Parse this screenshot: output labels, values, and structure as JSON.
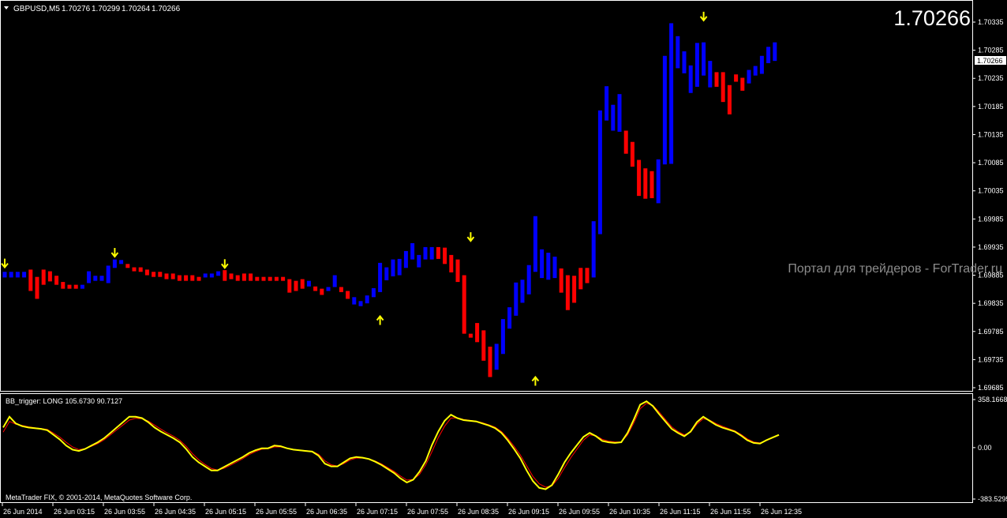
{
  "main_panel": {
    "symbol_header": "GBPUSD,M5",
    "ohlc_values": [
      "1.70276",
      "1.70299",
      "1.70264",
      "1.70266"
    ],
    "last_price_big": "1.70266",
    "current_price_tag": "1.70266",
    "watermark": "Портал для трейдеров - ForTrader.ru",
    "price_scale": [
      "1.70335",
      "1.70285",
      "1.70235",
      "1.70185",
      "1.70135",
      "1.70085",
      "1.70035",
      "1.69985",
      "1.69935",
      "1.69885",
      "1.69835",
      "1.69785",
      "1.69735",
      "1.69685"
    ]
  },
  "indicator_panel": {
    "label": "BB_trigger: LONG 105.6730 90.7127",
    "scale": [
      "358.1668",
      "0.00",
      "-383.5295"
    ],
    "copyright": "MetaTrader FIX, © 2001-2014, MetaQuotes Software Corp."
  },
  "time_axis": [
    "26 Jun 2014",
    "26 Jun 03:15",
    "26 Jun 03:55",
    "26 Jun 04:35",
    "26 Jun 05:15",
    "26 Jun 05:55",
    "26 Jun 06:35",
    "26 Jun 07:15",
    "26 Jun 07:55",
    "26 Jun 08:35",
    "26 Jun 09:15",
    "26 Jun 09:55",
    "26 Jun 10:35",
    "26 Jun 11:15",
    "26 Jun 11:55",
    "26 Jun 12:35"
  ],
  "colors": {
    "up": "#0000ff",
    "down": "#ff0000",
    "arrow": "#ffff00",
    "osc_main": "#ffff00",
    "osc_signal": "#ff0000",
    "axis": "#ffffff"
  },
  "chart_data": {
    "type": "bar",
    "bars": [
      {
        "open": 1.69891,
        "close": 1.69881,
        "dir": "up"
      },
      {
        "open": 1.69891,
        "close": 1.69881,
        "dir": "up"
      },
      {
        "open": 1.69891,
        "close": 1.69881,
        "dir": "up"
      },
      {
        "open": 1.69891,
        "close": 1.69881,
        "dir": "up"
      },
      {
        "open": 1.69895,
        "close": 1.69857,
        "dir": "down"
      },
      {
        "open": 1.69882,
        "close": 1.69843,
        "dir": "down"
      },
      {
        "open": 1.69895,
        "close": 1.69868,
        "dir": "down"
      },
      {
        "open": 1.69892,
        "close": 1.69874,
        "dir": "down"
      },
      {
        "open": 1.69884,
        "close": 1.69868,
        "dir": "down"
      },
      {
        "open": 1.69873,
        "close": 1.69861,
        "dir": "down"
      },
      {
        "open": 1.69868,
        "close": 1.69861,
        "dir": "down"
      },
      {
        "open": 1.69868,
        "close": 1.69861,
        "dir": "down"
      },
      {
        "open": 1.69861,
        "close": 1.69868,
        "dir": "up"
      },
      {
        "open": 1.69871,
        "close": 1.69892,
        "dir": "up"
      },
      {
        "open": 1.69875,
        "close": 1.69884,
        "dir": "up"
      },
      {
        "open": 1.69875,
        "close": 1.69884,
        "dir": "up"
      },
      {
        "open": 1.69871,
        "close": 1.69902,
        "dir": "up"
      },
      {
        "open": 1.69898,
        "close": 1.69913,
        "dir": "up"
      },
      {
        "open": 1.69905,
        "close": 1.69912,
        "dir": "up"
      },
      {
        "open": 1.69905,
        "close": 1.69899,
        "dir": "down"
      },
      {
        "open": 1.69899,
        "close": 1.69895,
        "dir": "down"
      },
      {
        "open": 1.69899,
        "close": 1.69891,
        "dir": "down"
      },
      {
        "open": 1.69895,
        "close": 1.69885,
        "dir": "down"
      },
      {
        "open": 1.69891,
        "close": 1.69882,
        "dir": "down"
      },
      {
        "open": 1.69891,
        "close": 1.69882,
        "dir": "down"
      },
      {
        "open": 1.69888,
        "close": 1.69878,
        "dir": "down"
      },
      {
        "open": 1.69888,
        "close": 1.69878,
        "dir": "down"
      },
      {
        "open": 1.69885,
        "close": 1.69875,
        "dir": "down"
      },
      {
        "open": 1.69885,
        "close": 1.69875,
        "dir": "down"
      },
      {
        "open": 1.69885,
        "close": 1.69875,
        "dir": "down"
      },
      {
        "open": 1.69882,
        "close": 1.69878,
        "dir": "down"
      },
      {
        "open": 1.69882,
        "close": 1.69888,
        "dir": "up"
      },
      {
        "open": 1.69882,
        "close": 1.69888,
        "dir": "up"
      },
      {
        "open": 1.69884,
        "close": 1.69892,
        "dir": "up"
      },
      {
        "open": 1.69894,
        "close": 1.69875,
        "dir": "down"
      },
      {
        "open": 1.69888,
        "close": 1.69878,
        "dir": "down"
      },
      {
        "open": 1.69885,
        "close": 1.69875,
        "dir": "down"
      },
      {
        "open": 1.69888,
        "close": 1.69875,
        "dir": "down"
      },
      {
        "open": 1.69888,
        "close": 1.69875,
        "dir": "down"
      },
      {
        "open": 1.69882,
        "close": 1.69875,
        "dir": "down"
      },
      {
        "open": 1.69882,
        "close": 1.69875,
        "dir": "down"
      },
      {
        "open": 1.69882,
        "close": 1.69875,
        "dir": "down"
      },
      {
        "open": 1.69882,
        "close": 1.69875,
        "dir": "down"
      },
      {
        "open": 1.69882,
        "close": 1.69875,
        "dir": "down"
      },
      {
        "open": 1.69878,
        "close": 1.69854,
        "dir": "down"
      },
      {
        "open": 1.69875,
        "close": 1.69857,
        "dir": "down"
      },
      {
        "open": 1.69878,
        "close": 1.69861,
        "dir": "down"
      },
      {
        "open": 1.69865,
        "close": 1.69875,
        "dir": "up"
      },
      {
        "open": 1.69865,
        "close": 1.69857,
        "dir": "down"
      },
      {
        "open": 1.69861,
        "close": 1.6985,
        "dir": "down"
      },
      {
        "open": 1.69857,
        "close": 1.69864,
        "dir": "up"
      },
      {
        "open": 1.69864,
        "close": 1.69885,
        "dir": "up"
      },
      {
        "open": 1.69864,
        "close": 1.69855,
        "dir": "down"
      },
      {
        "open": 1.69857,
        "close": 1.69843,
        "dir": "down"
      },
      {
        "open": 1.69833,
        "close": 1.69846,
        "dir": "up"
      },
      {
        "open": 1.6983,
        "close": 1.69839,
        "dir": "up"
      },
      {
        "open": 1.69835,
        "close": 1.69849,
        "dir": "up"
      },
      {
        "open": 1.69846,
        "close": 1.69862,
        "dir": "up"
      },
      {
        "open": 1.69855,
        "close": 1.69907,
        "dir": "up"
      },
      {
        "open": 1.69876,
        "close": 1.69899,
        "dir": "up"
      },
      {
        "open": 1.69883,
        "close": 1.69913,
        "dir": "up"
      },
      {
        "open": 1.69885,
        "close": 1.69914,
        "dir": "up"
      },
      {
        "open": 1.69898,
        "close": 1.69928,
        "dir": "up"
      },
      {
        "open": 1.69913,
        "close": 1.69942,
        "dir": "up"
      },
      {
        "open": 1.69899,
        "close": 1.69921,
        "dir": "up"
      },
      {
        "open": 1.69913,
        "close": 1.69935,
        "dir": "up"
      },
      {
        "open": 1.69913,
        "close": 1.69935,
        "dir": "up"
      },
      {
        "open": 1.69935,
        "close": 1.69914,
        "dir": "down"
      },
      {
        "open": 1.69934,
        "close": 1.69905,
        "dir": "down"
      },
      {
        "open": 1.69921,
        "close": 1.6989,
        "dir": "down"
      },
      {
        "open": 1.69913,
        "close": 1.69873,
        "dir": "down"
      },
      {
        "open": 1.69885,
        "close": 1.69781,
        "dir": "down"
      },
      {
        "open": 1.69781,
        "close": 1.6978,
        "dir": "down"
      },
      {
        "open": 1.698,
        "close": 1.69766,
        "dir": "down"
      },
      {
        "open": 1.69787,
        "close": 1.69733,
        "dir": "down"
      },
      {
        "open": 1.69758,
        "close": 1.69704,
        "dir": "down"
      },
      {
        "open": 1.69717,
        "close": 1.69763,
        "dir": "up"
      },
      {
        "open": 1.69745,
        "close": 1.69807,
        "dir": "up"
      },
      {
        "open": 1.6979,
        "close": 1.69828,
        "dir": "up"
      },
      {
        "open": 1.69813,
        "close": 1.69872,
        "dir": "up"
      },
      {
        "open": 1.69836,
        "close": 1.69877,
        "dir": "up"
      },
      {
        "open": 1.69851,
        "close": 1.69903,
        "dir": "up"
      },
      {
        "open": 1.69891,
        "close": 1.6999,
        "dir": "up"
      },
      {
        "open": 1.6988,
        "close": 1.69931,
        "dir": "up"
      },
      {
        "open": 1.69877,
        "close": 1.69925,
        "dir": "up"
      },
      {
        "open": 1.6988,
        "close": 1.69918,
        "dir": "up"
      },
      {
        "open": 1.69897,
        "close": 1.69854,
        "dir": "down"
      },
      {
        "open": 1.69885,
        "close": 1.69823,
        "dir": "down"
      },
      {
        "open": 1.69884,
        "close": 1.69836,
        "dir": "down"
      },
      {
        "open": 1.69898,
        "close": 1.6986,
        "dir": "down"
      },
      {
        "open": 1.69898,
        "close": 1.69871,
        "dir": "down"
      },
      {
        "open": 1.69881,
        "close": 1.69981,
        "dir": "up"
      },
      {
        "open": 1.69958,
        "close": 1.70178,
        "dir": "up"
      },
      {
        "open": 1.7016,
        "close": 1.70221,
        "dir": "up"
      },
      {
        "open": 1.70142,
        "close": 1.70188,
        "dir": "up"
      },
      {
        "open": 1.7014,
        "close": 1.70207,
        "dir": "up"
      },
      {
        "open": 1.70142,
        "close": 1.70101,
        "dir": "down"
      },
      {
        "open": 1.70122,
        "close": 1.70078,
        "dir": "down"
      },
      {
        "open": 1.7009,
        "close": 1.70026,
        "dir": "down"
      },
      {
        "open": 1.70075,
        "close": 1.70021,
        "dir": "down"
      },
      {
        "open": 1.7007,
        "close": 1.70022,
        "dir": "down"
      },
      {
        "open": 1.70013,
        "close": 1.70091,
        "dir": "up"
      },
      {
        "open": 1.70082,
        "close": 1.70275,
        "dir": "up"
      },
      {
        "open": 1.70083,
        "close": 1.70333,
        "dir": "up"
      },
      {
        "open": 1.70253,
        "close": 1.7031,
        "dir": "up"
      },
      {
        "open": 1.70244,
        "close": 1.70283,
        "dir": "up"
      },
      {
        "open": 1.70209,
        "close": 1.70258,
        "dir": "up"
      },
      {
        "open": 1.7022,
        "close": 1.70298,
        "dir": "up"
      },
      {
        "open": 1.7024,
        "close": 1.70299,
        "dir": "up"
      },
      {
        "open": 1.70219,
        "close": 1.70266,
        "dir": "up"
      },
      {
        "open": 1.70246,
        "close": 1.7022,
        "dir": "down"
      },
      {
        "open": 1.70246,
        "close": 1.70193,
        "dir": "down"
      },
      {
        "open": 1.70223,
        "close": 1.70171,
        "dir": "down"
      },
      {
        "open": 1.70242,
        "close": 1.70229,
        "dir": "down"
      },
      {
        "open": 1.70236,
        "close": 1.70213,
        "dir": "down"
      },
      {
        "open": 1.70226,
        "close": 1.7025,
        "dir": "up"
      },
      {
        "open": 1.7024,
        "close": 1.70257,
        "dir": "up"
      },
      {
        "open": 1.70243,
        "close": 1.70275,
        "dir": "up"
      },
      {
        "open": 1.70262,
        "close": 1.70291,
        "dir": "up"
      },
      {
        "open": 1.70266,
        "close": 1.70299,
        "dir": "up"
      }
    ],
    "arrows": [
      {
        "bar": 0,
        "type": "down",
        "price": 1.69906
      },
      {
        "bar": 17,
        "type": "down",
        "price": 1.69925
      },
      {
        "bar": 34,
        "type": "down",
        "price": 1.69905
      },
      {
        "bar": 58,
        "type": "up",
        "price": 1.69805
      },
      {
        "bar": 72,
        "type": "down",
        "price": 1.69953
      },
      {
        "bar": 82,
        "type": "up",
        "price": 1.69697
      },
      {
        "bar": 108,
        "type": "down",
        "price": 1.70345
      }
    ],
    "osc_main": [
      150,
      230,
      180,
      160,
      150,
      145,
      140,
      130,
      95,
      60,
      15,
      -15,
      -25,
      -10,
      15,
      40,
      70,
      110,
      150,
      190,
      230,
      230,
      220,
      190,
      150,
      120,
      95,
      70,
      40,
      -10,
      -70,
      -110,
      -140,
      -170,
      -170,
      -145,
      -120,
      -95,
      -70,
      -40,
      -20,
      -5,
      -5,
      15,
      10,
      -5,
      -15,
      -20,
      -25,
      -30,
      -60,
      -120,
      -140,
      -140,
      -110,
      -80,
      -70,
      -75,
      -85,
      -105,
      -130,
      -160,
      -190,
      -230,
      -260,
      -240,
      -180,
      -100,
      20,
      120,
      200,
      245,
      220,
      205,
      200,
      195,
      180,
      165,
      145,
      110,
      55,
      -10,
      -80,
      -170,
      -250,
      -300,
      -310,
      -280,
      -200,
      -110,
      -40,
      20,
      80,
      110,
      85,
      50,
      40,
      35,
      40,
      110,
      210,
      320,
      345,
      310,
      250,
      195,
      140,
      110,
      85,
      120,
      190,
      230,
      200,
      170,
      150,
      135,
      120,
      90,
      55,
      35,
      30,
      55,
      75,
      95
    ],
    "osc_signal": [
      115,
      195,
      175,
      165,
      155,
      148,
      142,
      135,
      108,
      78,
      40,
      5,
      -15,
      -8,
      10,
      30,
      58,
      95,
      132,
      168,
      205,
      218,
      215,
      198,
      168,
      138,
      110,
      85,
      55,
      10,
      -45,
      -90,
      -125,
      -155,
      -168,
      -155,
      -132,
      -108,
      -82,
      -52,
      -30,
      -12,
      -8,
      5,
      5,
      -5,
      -15,
      -20,
      -22,
      -28,
      -50,
      -98,
      -128,
      -138,
      -120,
      -92,
      -78,
      -78,
      -85,
      -100,
      -122,
      -150,
      -178,
      -212,
      -242,
      -238,
      -200,
      -128,
      -30,
      75,
      160,
      220,
      222,
      210,
      203,
      197,
      185,
      170,
      152,
      120,
      70,
      10,
      -55,
      -135,
      -215,
      -270,
      -295,
      -285,
      -230,
      -150,
      -75,
      -10,
      55,
      95,
      88,
      62,
      48,
      42,
      42,
      95,
      185,
      290,
      330,
      315,
      265,
      210,
      155,
      120,
      95,
      115,
      175,
      215,
      205,
      180,
      160,
      142,
      125,
      98,
      65,
      42,
      35,
      52,
      72,
      92
    ]
  }
}
